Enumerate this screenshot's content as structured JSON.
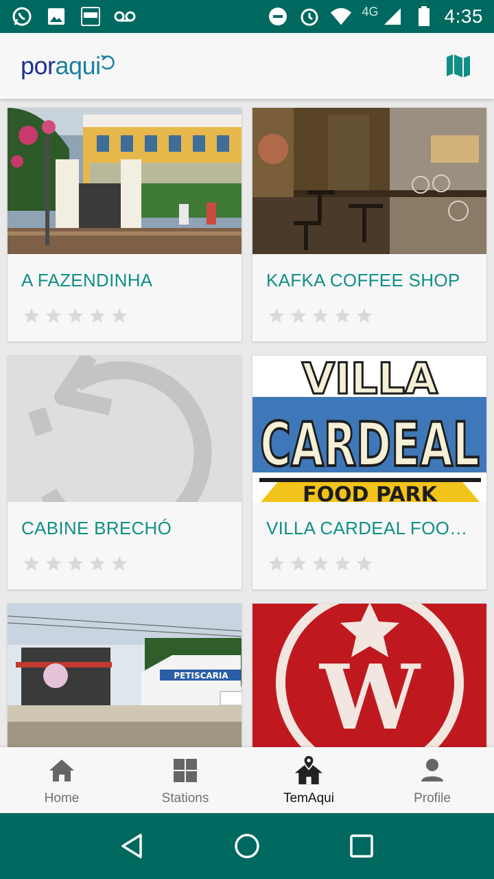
{
  "status_bar": {
    "time": "4:35",
    "network": "4G",
    "left_icons": [
      "whatsapp-icon",
      "image-icon",
      "calendar-widget-icon",
      "voicemail-icon"
    ],
    "right_icons": [
      "do-not-disturb-icon",
      "alarm-icon",
      "wifi-icon",
      "signal-icon",
      "battery-icon"
    ]
  },
  "app_bar": {
    "logo_part1": "por",
    "logo_part2": "aqui",
    "action_icon": "map-icon"
  },
  "places": [
    {
      "name": "A FAZENDINHA",
      "rating": 0,
      "image": "building-photo"
    },
    {
      "name": "KAFKA COFFEE SHOP",
      "rating": 0,
      "image": "cafe-interior-photo"
    },
    {
      "name": "CABINE BRECHÓ",
      "rating": 0,
      "image": "placeholder-logo"
    },
    {
      "name": "VILLA CARDEAL FOOD PARK",
      "rating": 0,
      "image": "villa-cardeal-logo",
      "logo_line1": "VILLA",
      "logo_line2": "CARDEAL",
      "logo_line3": "FOOD PARK"
    },
    {
      "name": "",
      "rating": 0,
      "image": "street-photo",
      "sign_text": "PETISCARIA"
    },
    {
      "name": "",
      "rating": 0,
      "image": "w-logo",
      "logo_letter": "W"
    }
  ],
  "bottom_nav": [
    {
      "label": "Home",
      "icon": "home-icon",
      "active": false
    },
    {
      "label": "Stations",
      "icon": "grid-icon",
      "active": false
    },
    {
      "label": "TemAqui",
      "icon": "house-pin-icon",
      "active": true
    },
    {
      "label": "Profile",
      "icon": "person-icon",
      "active": false
    }
  ],
  "colors": {
    "status_bar": "#00695f",
    "accent_title": "#0f8f85",
    "logo_blue": "#1f2f8a",
    "star_empty": "#d9d9d9"
  }
}
